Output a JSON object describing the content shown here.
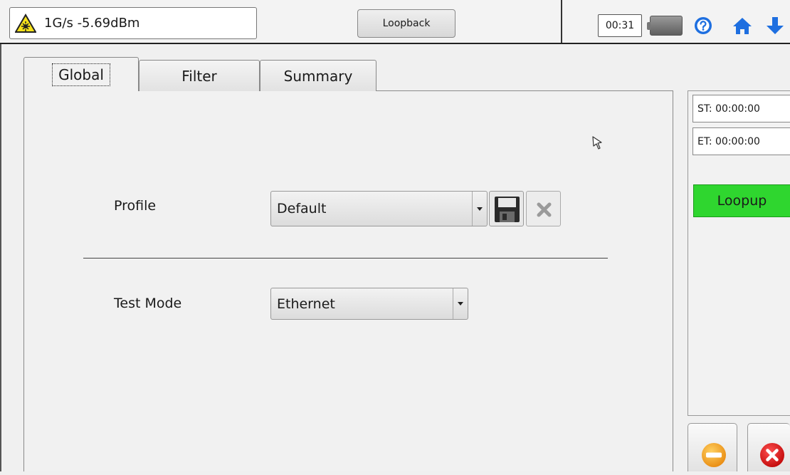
{
  "topbar": {
    "signal_text": "1G/s -5.69dBm",
    "mode_button": "Loopback",
    "timer": "00:31",
    "icons": [
      "warning-laser-icon",
      "battery-icon",
      "help-icon",
      "home-icon",
      "arrow-down-icon"
    ]
  },
  "tabs": [
    {
      "label": "Global",
      "active": true
    },
    {
      "label": "Filter",
      "active": false
    },
    {
      "label": "Summary",
      "active": false
    }
  ],
  "form": {
    "profile_label": "Profile",
    "profile_value": "Default",
    "test_mode_label": "Test Mode",
    "test_mode_value": "Ethernet"
  },
  "side": {
    "start_time": "ST:  00:00:00",
    "end_time": "ET:  00:00:00",
    "loopup_label": "Loopup"
  },
  "colors": {
    "loopup": "#2fd62f",
    "stop": "#f0a020",
    "close": "#e01010",
    "icon_blue": "#1e6fe0"
  }
}
